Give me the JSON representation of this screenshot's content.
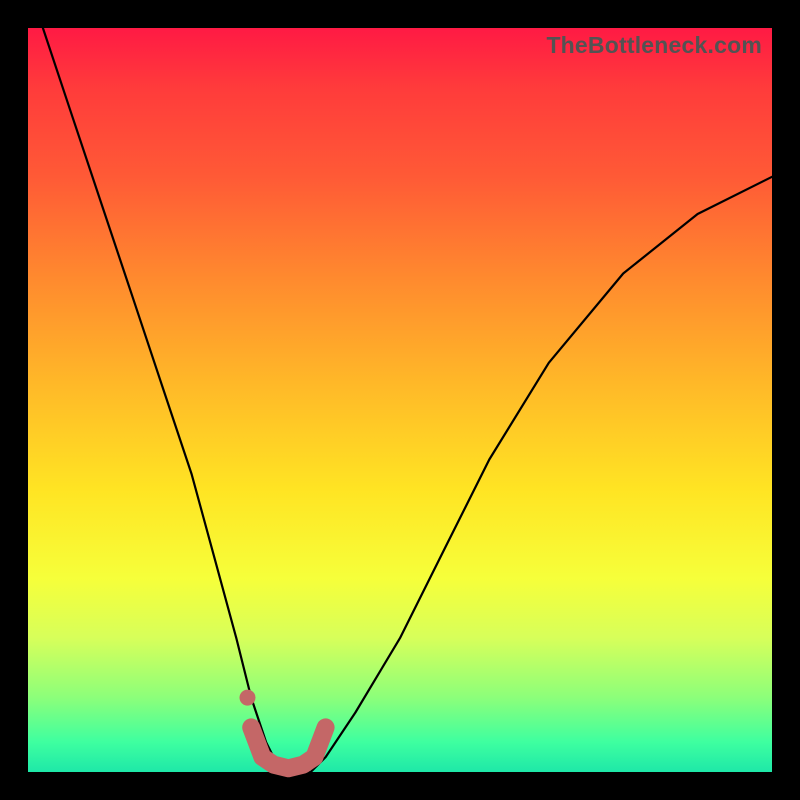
{
  "watermark": "TheBottleneck.com",
  "colors": {
    "frame": "#000000",
    "curve": "#000000",
    "marker": "#c46767",
    "gradient_top": "#ff1a44",
    "gradient_bottom": "#1ee8a8"
  },
  "chart_data": {
    "type": "line",
    "title": "",
    "xlabel": "",
    "ylabel": "",
    "xlim": [
      0,
      100
    ],
    "ylim": [
      0,
      100
    ],
    "series": [
      {
        "name": "bottleneck-curve",
        "x": [
          2,
          6,
          10,
          14,
          18,
          22,
          25,
          28,
          30,
          32,
          34,
          36,
          38,
          40,
          44,
          50,
          56,
          62,
          70,
          80,
          90,
          100
        ],
        "values": [
          100,
          88,
          76,
          64,
          52,
          40,
          29,
          18,
          10,
          4,
          0,
          0,
          0,
          2,
          8,
          18,
          30,
          42,
          55,
          67,
          75,
          80
        ]
      }
    ],
    "marker": {
      "name": "bottom-u-marker",
      "x": [
        30,
        31.5,
        33,
        35,
        37,
        38.5,
        40
      ],
      "values": [
        6,
        2,
        1,
        0.5,
        1,
        2,
        6
      ],
      "dot": {
        "x": 29.5,
        "y": 10
      }
    }
  }
}
